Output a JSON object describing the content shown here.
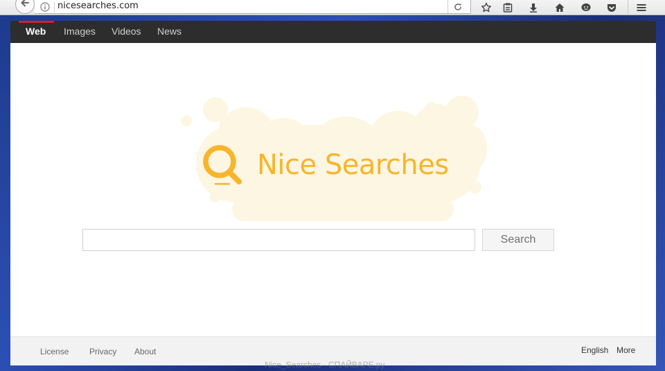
{
  "browser": {
    "url": "nicesearches.com",
    "icons": [
      "back-arrow-icon",
      "info-icon",
      "reload-icon",
      "bookmark-star-icon",
      "reading-list-icon",
      "download-icon",
      "home-icon",
      "chat-icon",
      "pocket-icon",
      "menu-icon"
    ]
  },
  "nav": {
    "tabs": [
      {
        "label": "Web",
        "active": true
      },
      {
        "label": "Images",
        "active": false
      },
      {
        "label": "Videos",
        "active": false
      },
      {
        "label": "News",
        "active": false
      }
    ]
  },
  "logo": {
    "text": "Nice Searches",
    "color": "#f7b52c",
    "cloud_color": "#fdf6e2"
  },
  "search": {
    "value": "",
    "button_label": "Search"
  },
  "footer": {
    "links_left": [
      "License",
      "Privacy",
      "About"
    ],
    "links_right": [
      "English",
      "More"
    ]
  },
  "watermark": "Nice_Searches - СПАЙВАРЕ.ру",
  "colors": {
    "nav_bg": "#2d2d2d",
    "active_tab_indicator": "#d62020",
    "desktop_bg": "#2c4fb5"
  }
}
